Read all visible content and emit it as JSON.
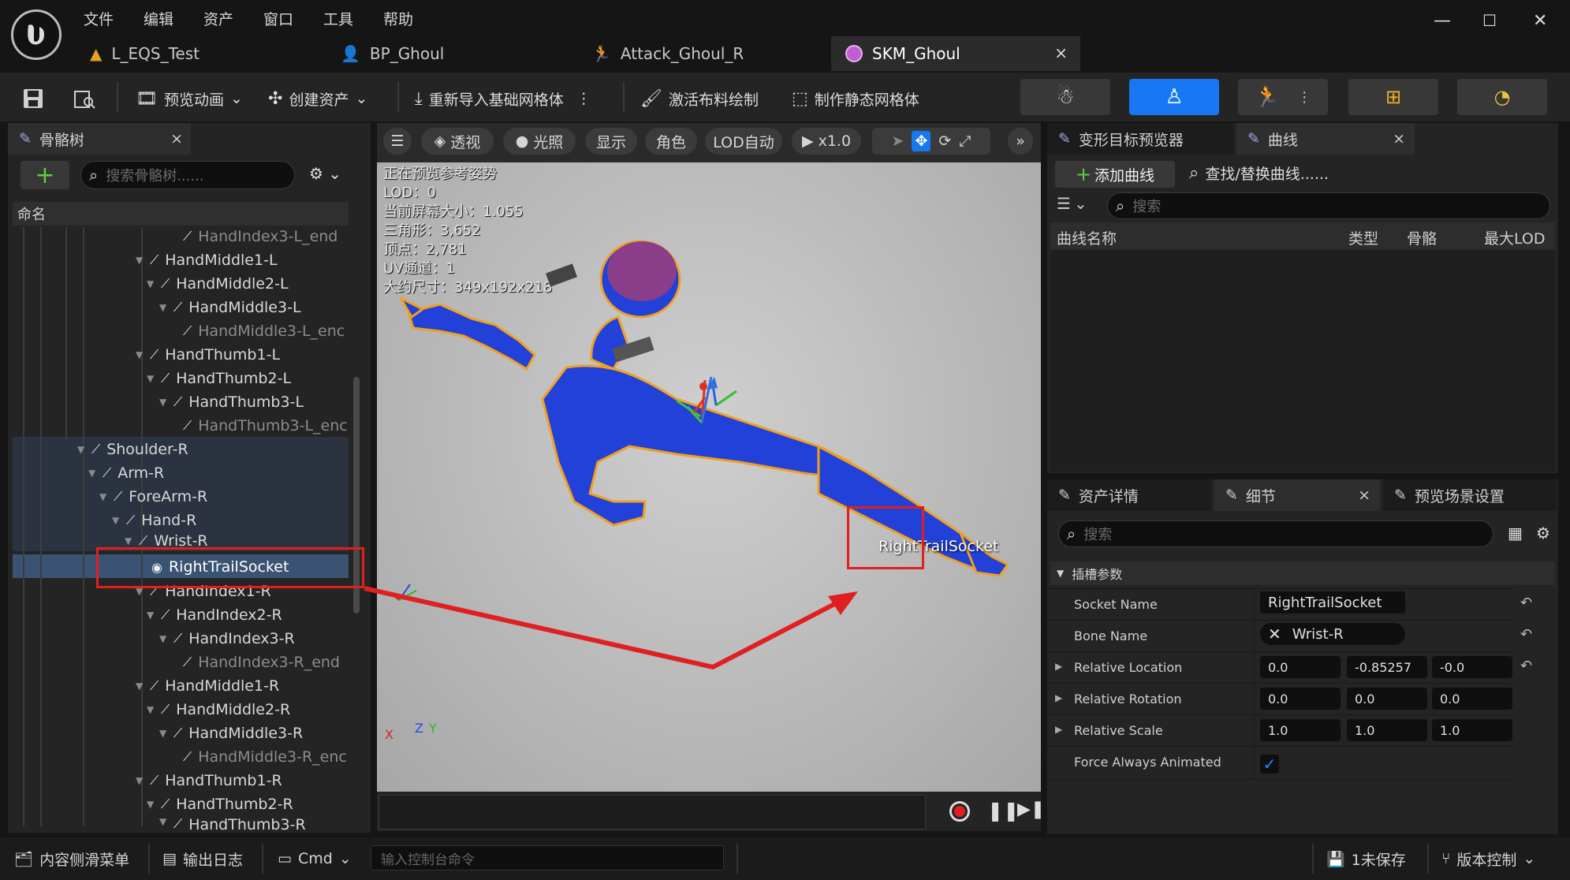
{
  "menu": [
    "文件",
    "编辑",
    "资产",
    "窗口",
    "工具",
    "帮助"
  ],
  "doc_tabs": [
    {
      "label": "L_EQS_Test",
      "icon": "level-icon"
    },
    {
      "label": "BP_Ghoul",
      "icon": "blueprint-icon"
    },
    {
      "label": "Attack_Ghoul_R",
      "icon": "animation-icon"
    },
    {
      "label": "SKM_Ghoul",
      "icon": "skeletal-mesh-icon",
      "close": "×"
    }
  ],
  "toolbar": {
    "preview_anim": "预览动画",
    "create_asset": "创建资产",
    "reimport": "重新导入基础网格体",
    "cloth_paint": "激活布料绘制",
    "make_static": "制作静态网格体"
  },
  "skeleton_panel": {
    "tab": "骨骼树",
    "close": "×",
    "search_placeholder": "搜索骨骼树......",
    "column": "命名",
    "rows": [
      {
        "label": "HandIndex3-L_end",
        "dim": true
      },
      {
        "label": "HandMiddle1-L"
      },
      {
        "label": "HandMiddle2-L"
      },
      {
        "label": "HandMiddle3-L"
      },
      {
        "label": "HandMiddle3-L_enc",
        "dim": true
      },
      {
        "label": "HandThumb1-L"
      },
      {
        "label": "HandThumb2-L"
      },
      {
        "label": "HandThumb3-L"
      },
      {
        "label": "HandThumb3-L_enc",
        "dim": true
      },
      {
        "label": "Shoulder-R"
      },
      {
        "label": "Arm-R"
      },
      {
        "label": "ForeArm-R"
      },
      {
        "label": "Hand-R"
      },
      {
        "label": "Wrist-R"
      },
      {
        "label": "RightTrailSocket"
      },
      {
        "label": "HandIndex1-R"
      },
      {
        "label": "HandIndex2-R"
      },
      {
        "label": "HandIndex3-R"
      },
      {
        "label": "HandIndex3-R_end",
        "dim": true
      },
      {
        "label": "HandMiddle1-R"
      },
      {
        "label": "HandMiddle2-R"
      },
      {
        "label": "HandMiddle3-R"
      },
      {
        "label": "HandMiddle3-R_enc",
        "dim": true
      },
      {
        "label": "HandThumb1-R"
      },
      {
        "label": "HandThumb2-R"
      },
      {
        "label": "HandThumb3-R"
      }
    ]
  },
  "viewport": {
    "perspective": "透视",
    "lighting": "光照",
    "show": "显示",
    "character": "角色",
    "lod": "LOD自动",
    "speed": "x1.0",
    "stats": [
      "正在预览参考姿势",
      "LOD：0",
      "当前屏幕大小：1.055",
      "三角形：3,652",
      "顶点：2,781",
      "UV通道：1",
      "大约尺寸：349x192x218"
    ],
    "socket_label": "RightTrailSocket",
    "axis_x": "X",
    "axis_z": "Z",
    "axis_y": "Y"
  },
  "curves_panel": {
    "tab_morph": "变形目标预览器",
    "tab_curves": "曲线",
    "close": "×",
    "add_curve": "添加曲线",
    "find_replace": "查找/替换曲线......",
    "search_placeholder": "搜索",
    "columns": [
      "曲线名称",
      "类型",
      "骨骼",
      "最大LOD"
    ]
  },
  "details_panel": {
    "tab_asset": "资产详情",
    "tab_details": "细节",
    "tab_scene": "预览场景设置",
    "close": "×",
    "search_placeholder": "搜索",
    "section": "插槽参数",
    "socket_name_label": "Socket Name",
    "socket_name": "RightTrailSocket",
    "bone_name_label": "Bone Name",
    "bone_name": "Wrist-R",
    "rel_loc_label": "Relative Location",
    "rel_loc": [
      "0.0",
      "-0.85257",
      "-0.0"
    ],
    "rel_rot_label": "Relative Rotation",
    "rel_rot": [
      "0.0",
      "0.0",
      "0.0"
    ],
    "rel_scale_label": "Relative Scale",
    "rel_scale": [
      "1.0",
      "1.0",
      "1.0"
    ],
    "force_anim_label": "Force Always Animated",
    "force_anim": true
  },
  "statusbar": {
    "content_drawer": "内容侧滑菜单",
    "output_log": "输出日志",
    "cmd": "Cmd",
    "console_placeholder": "输入控制台命令",
    "unsaved": "1未保存",
    "source_control": "版本控制"
  },
  "colors": {
    "accent": "#1877f2",
    "highlight": "#e02020",
    "mesh": "#1e3fd0",
    "selection": "#3a4a5e"
  }
}
